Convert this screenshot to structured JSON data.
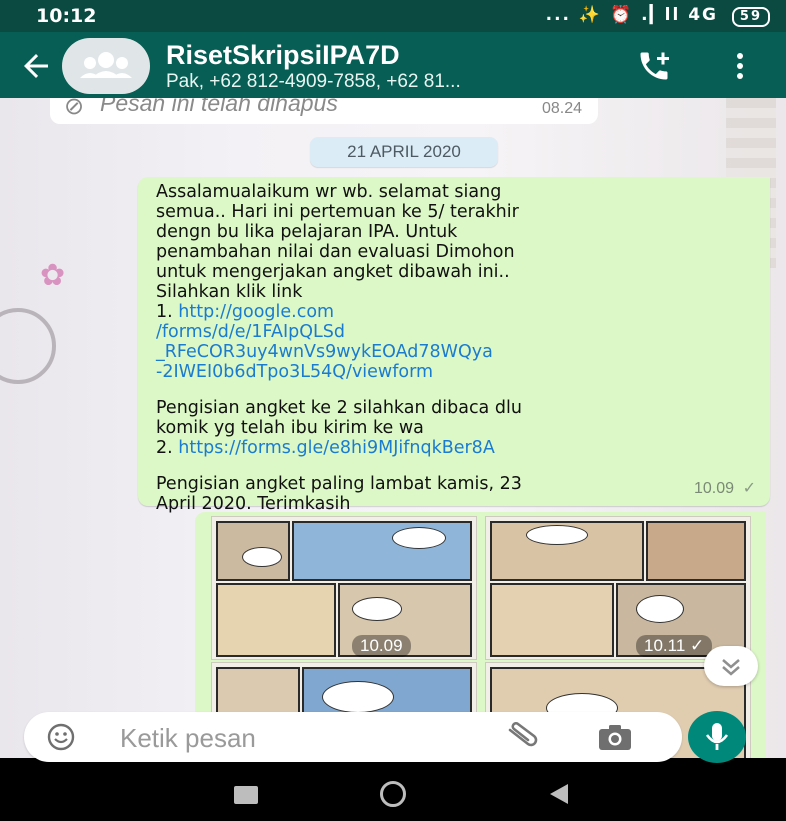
{
  "status_bar": {
    "time": "10:12",
    "indicators": "... ✨ ⏰ .▎ll 4G",
    "battery": "59"
  },
  "header": {
    "title": "RisetSkripsiIPA7D",
    "subtitle": "Pak, +62 812-4909-7858, +62 81...",
    "icons": [
      "back-arrow-icon",
      "group-avatar-icon",
      "add-call-icon",
      "more-vert-icon"
    ]
  },
  "chat": {
    "deleted_message": {
      "text": "Pesan ini telah dihapus",
      "time": "08.24"
    },
    "date_chip": "21 APRIL 2020",
    "message": {
      "lines": [
        "Assalamualaikum wr wb. selamat siang",
        "semua.. Hari ini pertemuan ke 5/ terakhir",
        "dengn bu lika pelajaran IPA. Untuk",
        "penambahan nilai dan evaluasi Dimohon",
        "untuk mengerjakan angket  dibawah ini..",
        "Silahkan klik link"
      ],
      "link1_prefix": "1. ",
      "link1_lines": [
        "http://google.com",
        "/forms/d/e/1FAIpQLSd",
        "_RFeCOR3uy4wnVs9wykEOAd78WQya",
        "-2IWEI0b6dTpo3L54Q/viewform"
      ],
      "lines2": [
        "Pengisian angket ke 2 silahkan dibaca dlu",
        "komik yg telah ibu kirim ke wa"
      ],
      "link2_prefix": "2. ",
      "link2": "https://forms.gle/e8hi9MJifnqkBer8A",
      "lines3": [
        "Pengisian angket paling lambat kamis, 23",
        "April 2020. Terimkasih"
      ],
      "time": "10.09",
      "status": "✓"
    },
    "images": [
      {
        "time": "10.09"
      },
      {
        "time": "10.11",
        "status": "✓"
      }
    ]
  },
  "input_bar": {
    "placeholder": "Ketik pesan",
    "icons": [
      "emoji-icon",
      "attach-icon",
      "camera-icon",
      "mic-icon"
    ]
  },
  "nav_bar": {
    "icons": [
      "recent-apps-icon",
      "home-icon",
      "back-icon"
    ]
  },
  "colors": {
    "header": "#075e54",
    "status_bar": "#0a4a40",
    "outgoing_bubble": "#dcf8c6",
    "link": "#1a7bd1",
    "accent": "#00897b"
  }
}
